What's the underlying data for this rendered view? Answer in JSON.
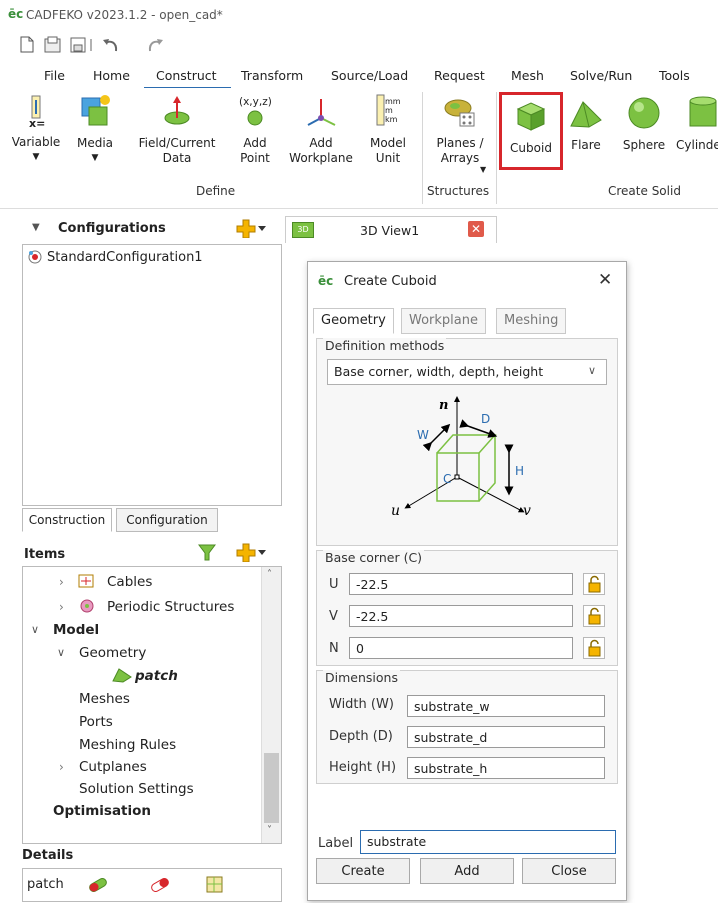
{
  "window": {
    "title": "CADFEKO v2023.1.2 - open_cad*"
  },
  "menu_tabs": [
    "File",
    "Home",
    "Construct",
    "Transform",
    "Source/Load",
    "Request",
    "Mesh",
    "Solve/Run",
    "Tools"
  ],
  "ribbon": {
    "variable": "Variable",
    "media": "Media",
    "field_current_data": "Field/Current\nData",
    "add_point": "Add\nPoint",
    "add_point_icon_text": "(x,y,z)",
    "add_workplane": "Add\nWorkplane",
    "model_unit": "Model\nUnit",
    "model_unit_icon_text": "mm\nm\nkm",
    "planes_arrays": "Planes /\nArrays",
    "cuboid": "Cuboid",
    "flare": "Flare",
    "sphere": "Sphere",
    "cylinder": "Cylinde",
    "variable_icon_text": "x=",
    "group_define": "Define",
    "group_structures": "Structures",
    "group_create_solid": "Create Solid"
  },
  "left_panel": {
    "configurations_title": "Configurations",
    "configurations": [
      "StandardConfiguration1"
    ],
    "tabs": [
      "Construction",
      "Configuration"
    ],
    "items_title": "Items",
    "tree": [
      {
        "label": "Cables",
        "bold": false
      },
      {
        "label": "Periodic Structures",
        "bold": false
      },
      {
        "label": "Model",
        "bold": true
      },
      {
        "label": "Geometry",
        "bold": false
      },
      {
        "label": "patch",
        "bold": true
      },
      {
        "label": "Meshes",
        "bold": false
      },
      {
        "label": "Ports",
        "bold": false
      },
      {
        "label": "Meshing Rules",
        "bold": false
      },
      {
        "label": "Cutplanes",
        "bold": false
      },
      {
        "label": "Solution Settings",
        "bold": false
      },
      {
        "label": "Optimisation",
        "bold": true
      }
    ],
    "details_title": "Details",
    "details_item": "patch"
  },
  "view_tab": {
    "label": "3D View1",
    "badge": "3D"
  },
  "dialog": {
    "title": "Create Cuboid",
    "tabs": [
      "Geometry",
      "Workplane",
      "Meshing"
    ],
    "definition_methods_label": "Definition methods",
    "definition_method": "Base corner, width, depth, height",
    "diagram_labels": {
      "n": "n",
      "d": "D",
      "w": "W",
      "h": "H",
      "c": "C",
      "u": "u",
      "v": "v"
    },
    "base_corner_label": "Base corner (C)",
    "base_corner": [
      {
        "axis": "U",
        "value": "-22.5"
      },
      {
        "axis": "V",
        "value": "-22.5"
      },
      {
        "axis": "N",
        "value": "0"
      }
    ],
    "dimensions_label": "Dimensions",
    "dimensions": [
      {
        "label": "Width (W)",
        "value": "substrate_w"
      },
      {
        "label": "Depth (D)",
        "value": "substrate_d"
      },
      {
        "label": "Height (H)",
        "value": "substrate_h"
      }
    ],
    "label_field_label": "Label",
    "label_value": "substrate",
    "buttons": [
      "Create",
      "Add",
      "Close"
    ]
  },
  "colors": {
    "highlight_red": "#d7262b",
    "cuboid_green": "#7cc142",
    "accent_blue": "#2b6cb0"
  }
}
